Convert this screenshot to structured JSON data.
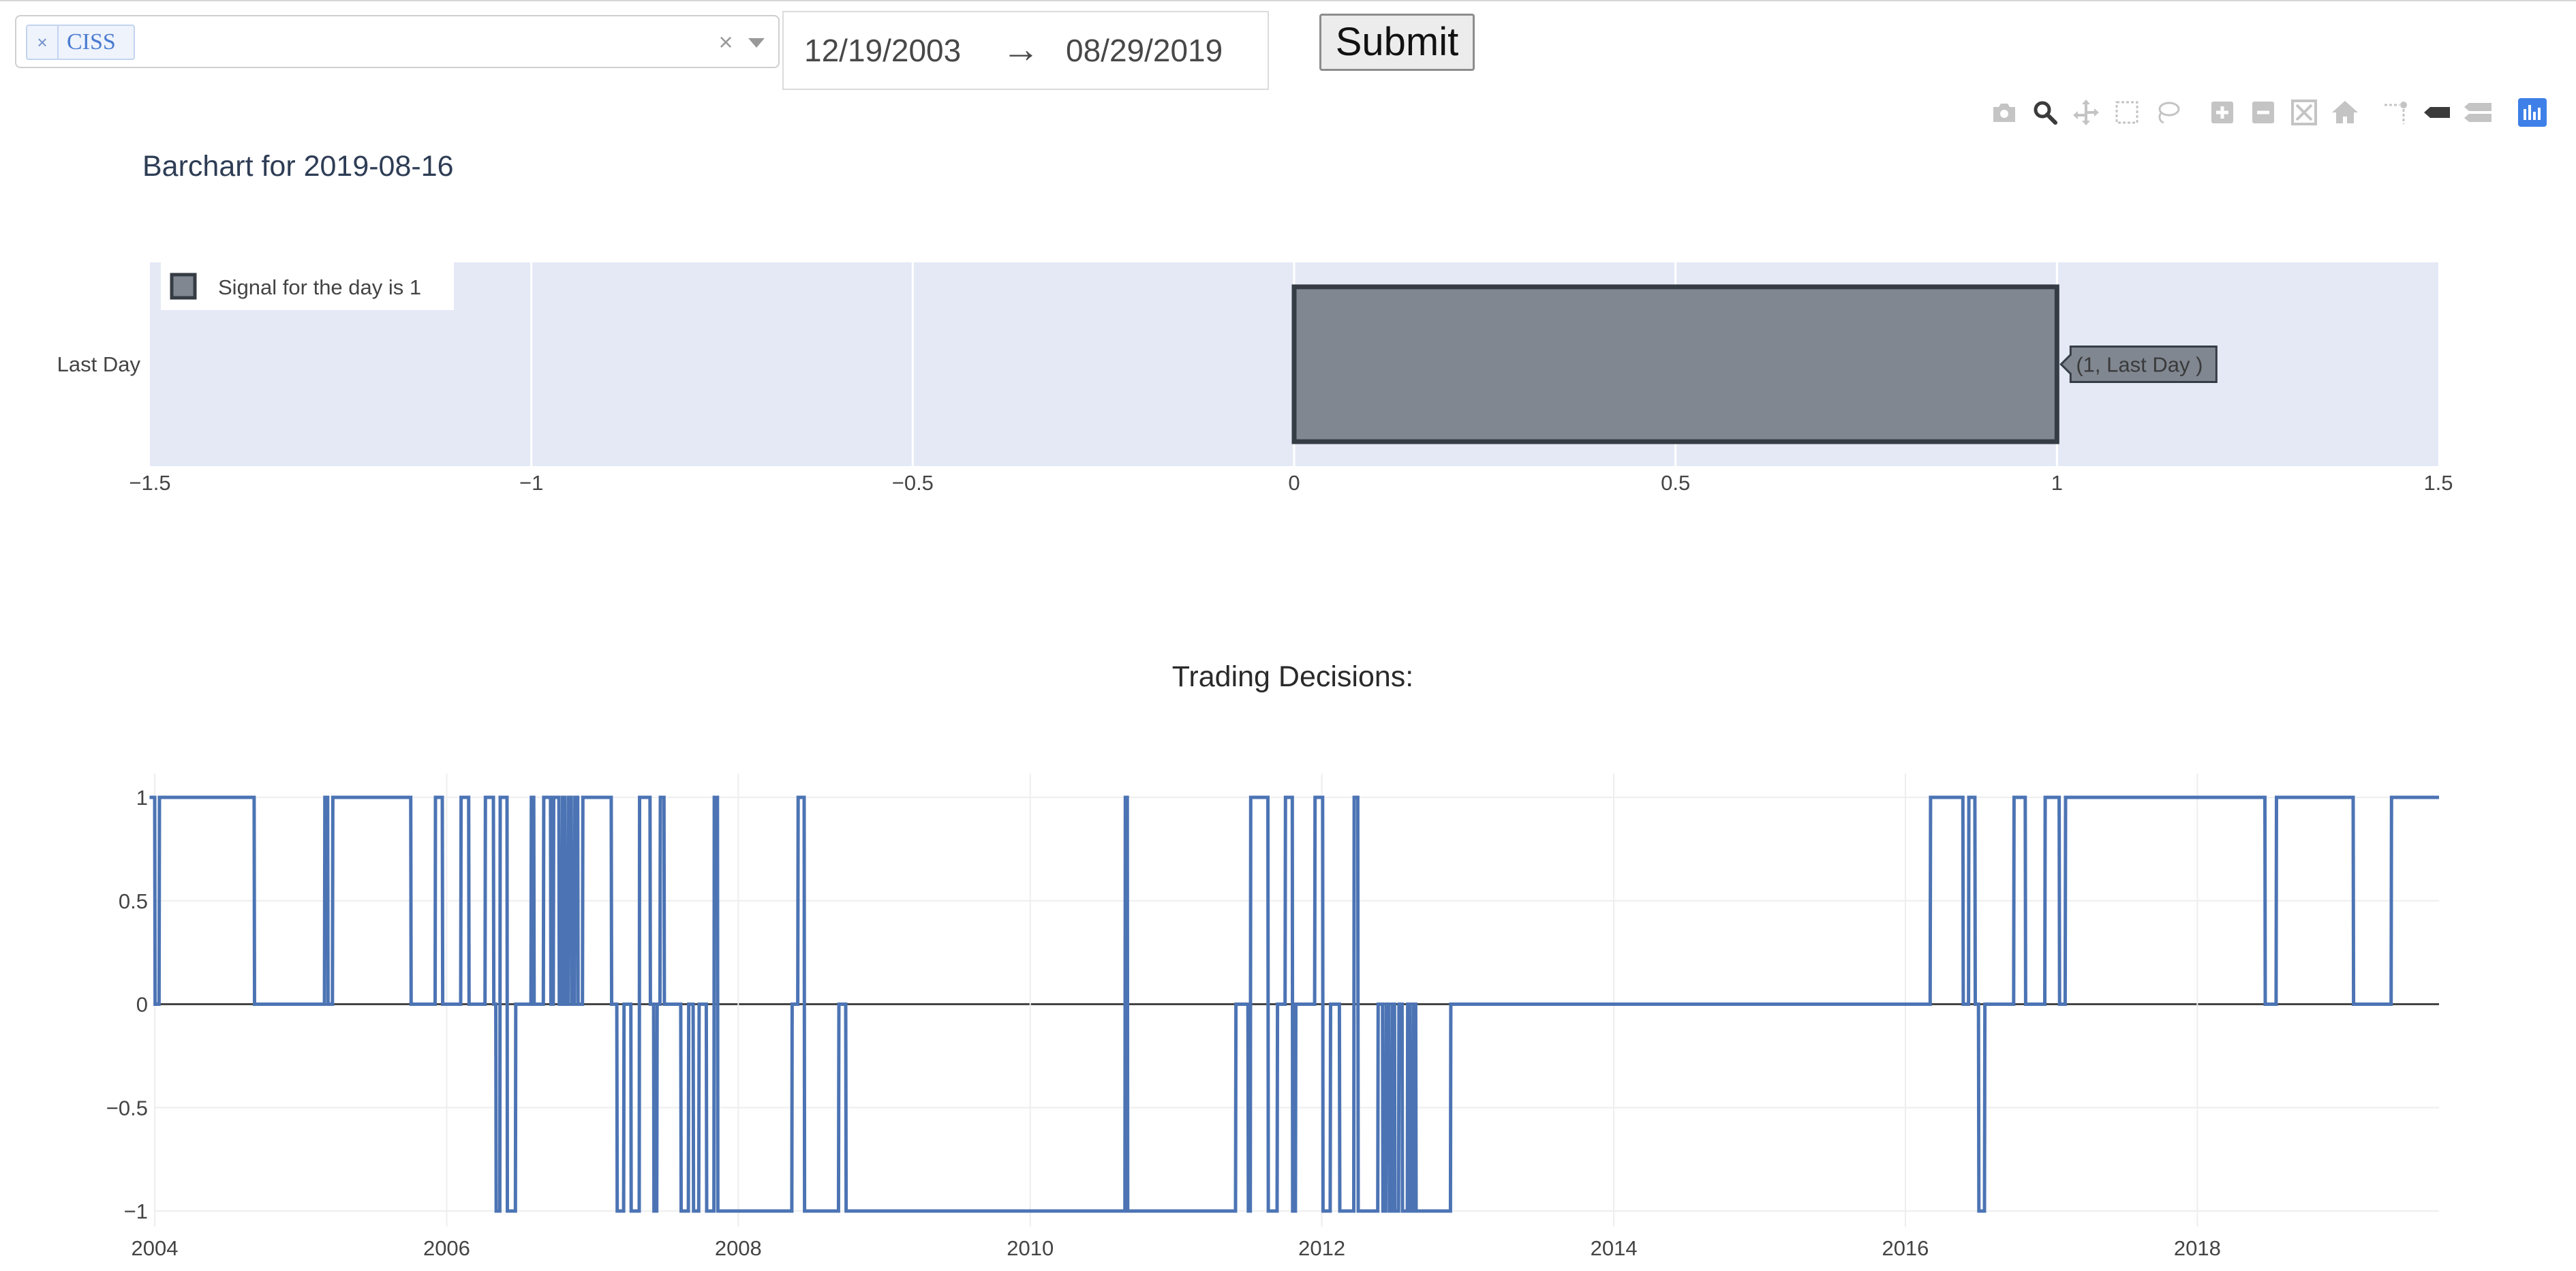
{
  "controls": {
    "selected_tag": "CISS",
    "tag_remove": "×",
    "clear_all": "×",
    "start_date": "12/19/2003",
    "arrow": "→",
    "end_date": "08/29/2019",
    "submit_label": "Submit"
  },
  "modebar": {
    "icons": [
      "camera-icon",
      "zoom-icon",
      "pan-icon",
      "box-select-icon",
      "lasso-select-icon",
      "zoom-in-icon",
      "zoom-out-icon",
      "autoscale-icon",
      "reset-axes-icon",
      "spike-lines-icon",
      "hover-closest-icon",
      "hover-compare-icon",
      "plotly-logo-icon"
    ],
    "active_color": "#3b3b3b",
    "inactive_color": "#c4c4c4",
    "logo_color": "#3f80e8"
  },
  "chart_data": [
    {
      "type": "bar",
      "orientation": "horizontal",
      "title": "Barchart for 2019-08-16",
      "categories": [
        "Last Day"
      ],
      "series": [
        {
          "name": "Signal for the day is 1",
          "values": [
            1
          ],
          "color": "#808791",
          "border_color": "#363c44"
        }
      ],
      "hover_label": "(1, Last Day )",
      "xlim": [
        -1.5,
        1.5
      ],
      "x_ticks": [
        -1.5,
        -1,
        -0.5,
        0,
        0.5,
        1,
        1.5
      ],
      "x_tick_labels": [
        "−1.5",
        "−1",
        "−0.5",
        "0",
        "0.5",
        "1",
        "1.5"
      ],
      "legend_position": "top-left",
      "plot_bgcolor": "#e5e9f6",
      "grid": true
    },
    {
      "type": "line",
      "title": "Trading Decisions:",
      "color": "#4c74b4",
      "ylim": [
        -1,
        1
      ],
      "y_ticks": [
        1,
        0.5,
        0,
        -0.5,
        -1
      ],
      "y_tick_labels": [
        "1",
        "0.5",
        "0",
        "−0.5",
        "−1"
      ],
      "xlim": [
        "2004-01-01",
        "2019-08-29"
      ],
      "x_tick_labels": [
        "2004",
        "2006",
        "2008",
        "2010",
        "2012",
        "2014",
        "2016",
        "2018"
      ],
      "grid": true,
      "x": [
        "2003-12-19",
        "2004-01-01",
        "2004-01-02",
        "2004-01-12",
        "2004-01-13",
        "2004-09-06",
        "2004-09-07",
        "2005-03-01",
        "2005-03-02",
        "2005-03-09",
        "2005-03-10",
        "2005-03-21",
        "2005-03-22",
        "2005-10-03",
        "2005-10-04",
        "2005-12-03",
        "2005-12-04",
        "2005-12-21",
        "2005-12-22",
        "2006-02-05",
        "2006-02-06",
        "2006-02-25",
        "2006-02-26",
        "2006-04-07",
        "2006-04-08",
        "2006-04-28",
        "2006-04-29",
        "2006-05-04",
        "2006-05-05",
        "2006-05-14",
        "2006-05-15",
        "2006-06-01",
        "2006-06-02",
        "2006-06-22",
        "2006-06-23",
        "2006-07-31",
        "2006-08-01",
        "2006-08-07",
        "2006-08-08",
        "2006-08-31",
        "2006-09-01",
        "2006-09-18",
        "2006-09-19",
        "2006-09-25",
        "2006-09-26",
        "2006-10-09",
        "2006-10-10",
        "2006-10-17",
        "2006-10-18",
        "2006-10-24",
        "2006-10-25",
        "2006-11-01",
        "2006-11-02",
        "2006-11-09",
        "2006-11-10",
        "2006-11-17",
        "2006-11-18",
        "2006-11-25",
        "2006-11-26",
        "2006-12-07",
        "2006-12-08",
        "2007-02-17",
        "2007-02-18",
        "2007-03-03",
        "2007-03-04",
        "2007-03-20",
        "2007-03-21",
        "2007-04-07",
        "2007-04-08",
        "2007-04-28",
        "2007-04-29",
        "2007-05-25",
        "2007-05-26",
        "2007-06-03",
        "2007-06-04",
        "2007-06-11",
        "2007-06-12",
        "2007-06-19",
        "2007-06-20",
        "2007-06-29",
        "2007-06-30",
        "2007-08-10",
        "2007-08-11",
        "2007-08-29",
        "2007-08-30",
        "2007-09-10",
        "2007-09-11",
        "2007-09-24",
        "2007-09-25",
        "2007-10-13",
        "2007-10-14",
        "2007-11-01",
        "2007-11-02",
        "2007-11-10",
        "2007-11-11",
        "2008-05-14",
        "2008-05-15",
        "2008-05-29",
        "2008-05-30",
        "2008-06-14",
        "2008-06-15",
        "2008-09-08",
        "2008-09-09",
        "2008-09-26",
        "2008-09-27",
        "2010-08-26",
        "2010-08-27",
        "2010-09-01",
        "2010-09-02",
        "2011-05-30",
        "2011-05-31",
        "2011-06-30",
        "2011-07-01",
        "2011-07-06",
        "2011-07-07",
        "2011-08-19",
        "2011-08-20",
        "2011-09-11",
        "2011-09-12",
        "2011-10-01",
        "2011-10-02",
        "2011-10-19",
        "2011-10-20",
        "2011-10-27",
        "2011-10-28",
        "2011-12-14",
        "2011-12-15",
        "2012-01-03",
        "2012-01-04",
        "2012-01-22",
        "2012-01-23",
        "2012-02-14",
        "2012-02-15",
        "2012-03-21",
        "2012-03-22",
        "2012-03-31",
        "2012-04-01",
        "2012-05-20",
        "2012-05-21",
        "2012-06-01",
        "2012-06-02",
        "2012-06-09",
        "2012-06-10",
        "2012-06-17",
        "2012-06-18",
        "2012-06-25",
        "2012-06-26",
        "2012-07-01",
        "2012-07-02",
        "2012-07-11",
        "2012-07-12",
        "2012-07-20",
        "2012-07-21",
        "2012-08-02",
        "2012-08-03",
        "2012-08-09",
        "2012-08-10",
        "2012-08-17",
        "2012-08-18",
        "2012-08-23",
        "2012-08-24",
        "2012-11-18",
        "2012-11-19",
        "2016-03-03",
        "2016-03-04",
        "2016-05-24",
        "2016-05-25",
        "2016-06-07",
        "2016-06-08",
        "2016-06-23",
        "2016-06-24",
        "2016-07-02",
        "2016-07-03",
        "2016-07-17",
        "2016-07-18",
        "2016-09-28",
        "2016-09-29",
        "2016-10-27",
        "2016-10-28",
        "2016-12-15",
        "2016-12-16",
        "2017-01-20",
        "2017-01-21",
        "2017-02-04",
        "2017-02-05",
        "2018-06-19",
        "2018-06-20",
        "2018-07-17",
        "2018-07-18",
        "2019-01-26",
        "2019-01-27",
        "2019-05-01",
        "2019-05-02",
        "2019-08-29"
      ],
      "y": [
        1,
        1,
        0,
        0,
        1,
        1,
        0,
        0,
        1,
        1,
        0,
        0,
        1,
        1,
        0,
        0,
        1,
        1,
        0,
        0,
        1,
        1,
        0,
        0,
        1,
        1,
        0,
        0,
        -1,
        -1,
        1,
        1,
        -1,
        -1,
        0,
        0,
        1,
        1,
        0,
        0,
        1,
        1,
        0,
        0,
        1,
        1,
        0,
        0,
        1,
        1,
        0,
        0,
        1,
        1,
        0,
        0,
        1,
        1,
        0,
        0,
        1,
        1,
        0,
        0,
        -1,
        -1,
        0,
        0,
        -1,
        -1,
        1,
        1,
        0,
        0,
        -1,
        -1,
        0,
        0,
        1,
        1,
        0,
        0,
        -1,
        -1,
        0,
        0,
        -1,
        -1,
        0,
        0,
        -1,
        -1,
        1,
        1,
        -1,
        -1,
        0,
        0,
        1,
        1,
        -1,
        -1,
        0,
        0,
        -1,
        -1,
        1,
        1,
        -1,
        -1,
        0,
        0,
        -1,
        -1,
        1,
        1,
        -1,
        -1,
        0,
        0,
        1,
        1,
        -1,
        -1,
        0,
        0,
        1,
        1,
        -1,
        -1,
        0,
        0,
        -1,
        -1,
        1,
        1,
        -1,
        -1,
        0,
        0,
        -1,
        -1,
        0,
        0,
        -1,
        -1,
        0,
        0,
        -1,
        -1,
        0,
        0,
        -1,
        -1,
        0,
        0,
        -1,
        -1,
        0,
        0,
        -1,
        -1,
        0,
        0,
        1,
        1,
        0,
        0,
        1,
        1,
        0,
        0,
        -1,
        -1,
        0,
        0,
        1,
        1,
        0,
        0,
        1,
        1,
        0,
        0,
        1,
        1,
        0,
        0,
        1,
        1,
        0,
        0,
        1,
        1,
        0,
        0,
        1,
        1
      ]
    }
  ]
}
